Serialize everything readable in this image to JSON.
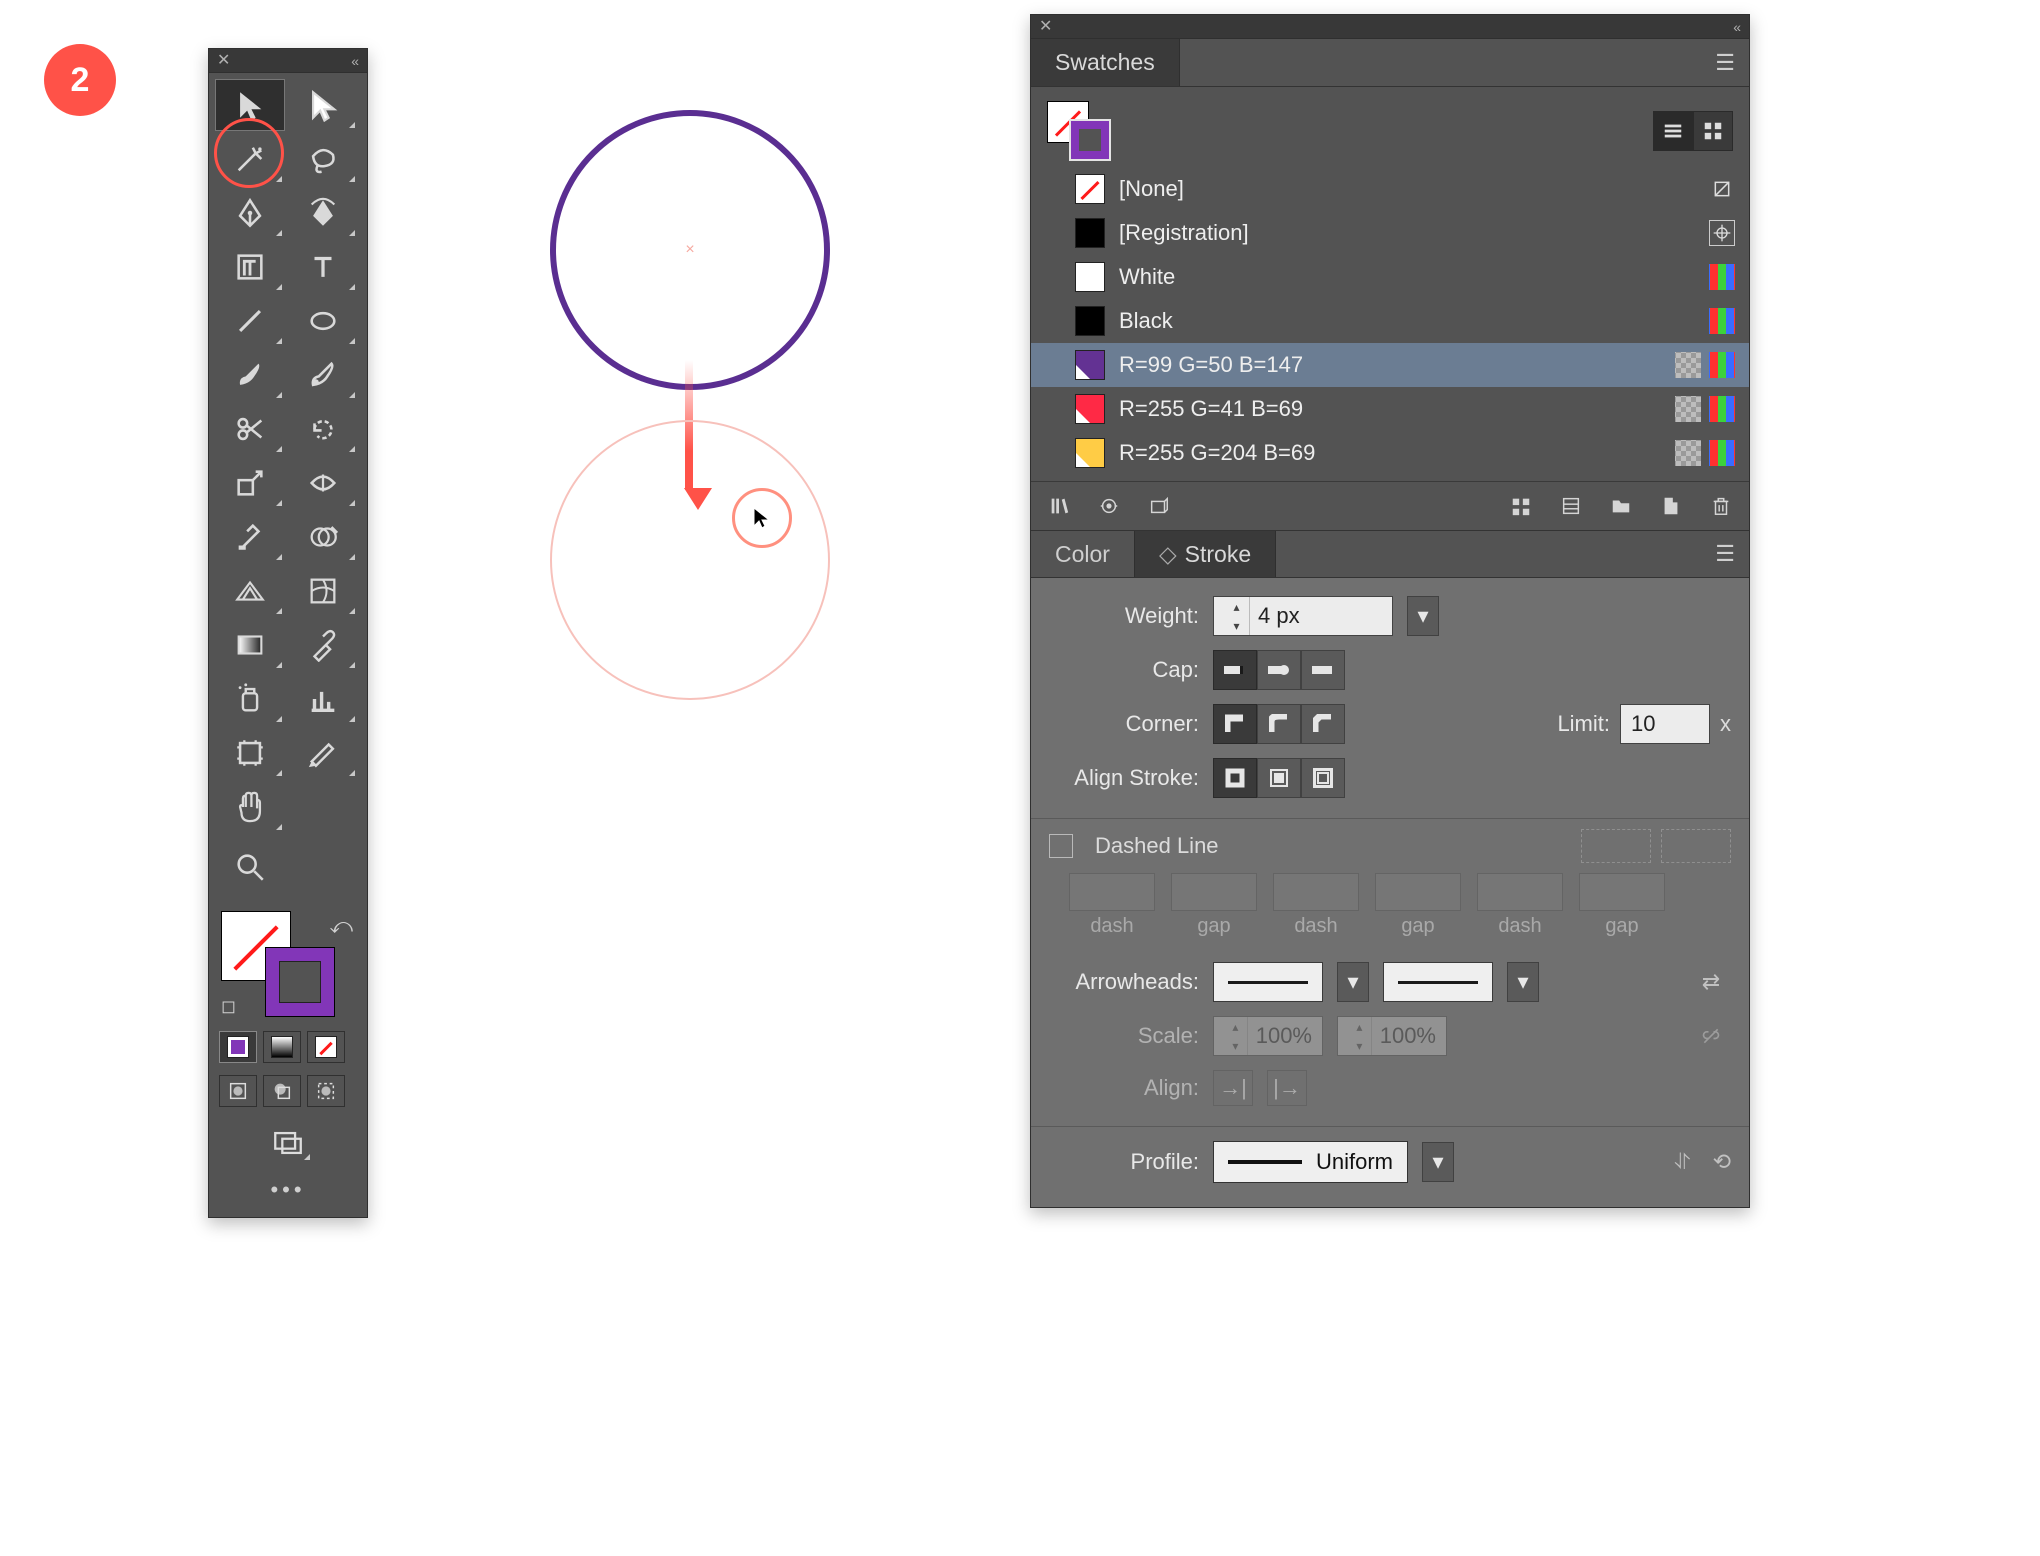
{
  "step_badge": "2",
  "tools": {
    "items": [
      {
        "name": "selection-tool",
        "selected": true
      },
      {
        "name": "direct-selection-tool"
      },
      {
        "name": "magic-wand-tool"
      },
      {
        "name": "lasso-tool"
      },
      {
        "name": "pen-tool"
      },
      {
        "name": "curvature-tool"
      },
      {
        "name": "area-type-tool"
      },
      {
        "name": "type-tool"
      },
      {
        "name": "line-segment-tool"
      },
      {
        "name": "ellipse-tool"
      },
      {
        "name": "paintbrush-tool"
      },
      {
        "name": "blob-brush-tool"
      },
      {
        "name": "scissors-tool"
      },
      {
        "name": "rotate-tool"
      },
      {
        "name": "scale-tool"
      },
      {
        "name": "width-tool"
      },
      {
        "name": "anchor-tool"
      },
      {
        "name": "shape-builder-tool"
      },
      {
        "name": "perspective-grid-tool"
      },
      {
        "name": "mesh-tool"
      },
      {
        "name": "gradient-tool"
      },
      {
        "name": "eyedropper-tool"
      },
      {
        "name": "symbol-sprayer-tool"
      },
      {
        "name": "column-graph-tool"
      },
      {
        "name": "artboard-tool"
      },
      {
        "name": "slice-tool"
      },
      {
        "name": "hand-tool"
      }
    ],
    "zoom_tool": {
      "name": "zoom-tool"
    },
    "fill_color": "none",
    "stroke_color": "#8236b8"
  },
  "swatches": {
    "tab_label": "Swatches",
    "items": [
      {
        "label": "[None]",
        "chip": "none",
        "icons": [
          "noedit"
        ]
      },
      {
        "label": "[Registration]",
        "chip": "#000000",
        "icons": [
          "registration"
        ]
      },
      {
        "label": "White",
        "chip": "#ffffff",
        "icons": [
          "rgb"
        ]
      },
      {
        "label": "Black",
        "chip": "#000000",
        "icons": [
          "rgb"
        ]
      },
      {
        "label": "R=99 G=50 B=147",
        "chip": "#633293",
        "icons": [
          "global",
          "rgb"
        ],
        "selected": true,
        "tri": true
      },
      {
        "label": "R=255 G=41 B=69",
        "chip": "#ff2945",
        "icons": [
          "global",
          "rgb"
        ],
        "tri": true
      },
      {
        "label": "R=255 G=204 B=69",
        "chip": "#ffcc45",
        "icons": [
          "global",
          "rgb"
        ],
        "tri": true
      }
    ]
  },
  "stroke": {
    "tab_color_label": "Color",
    "tab_stroke_label": "Stroke",
    "weight_label": "Weight:",
    "weight_value": "4 px",
    "cap_label": "Cap:",
    "corner_label": "Corner:",
    "limit_label": "Limit:",
    "limit_value": "10",
    "limit_suffix": "x",
    "align_label": "Align Stroke:",
    "dashed_label": "Dashed Line",
    "dash_labels": [
      "dash",
      "gap",
      "dash",
      "gap",
      "dash",
      "gap"
    ],
    "arrow_label": "Arrowheads:",
    "scale_label": "Scale:",
    "scale_value": "100%",
    "align_arrow_label": "Align:",
    "profile_label": "Profile:",
    "profile_value": "Uniform"
  }
}
